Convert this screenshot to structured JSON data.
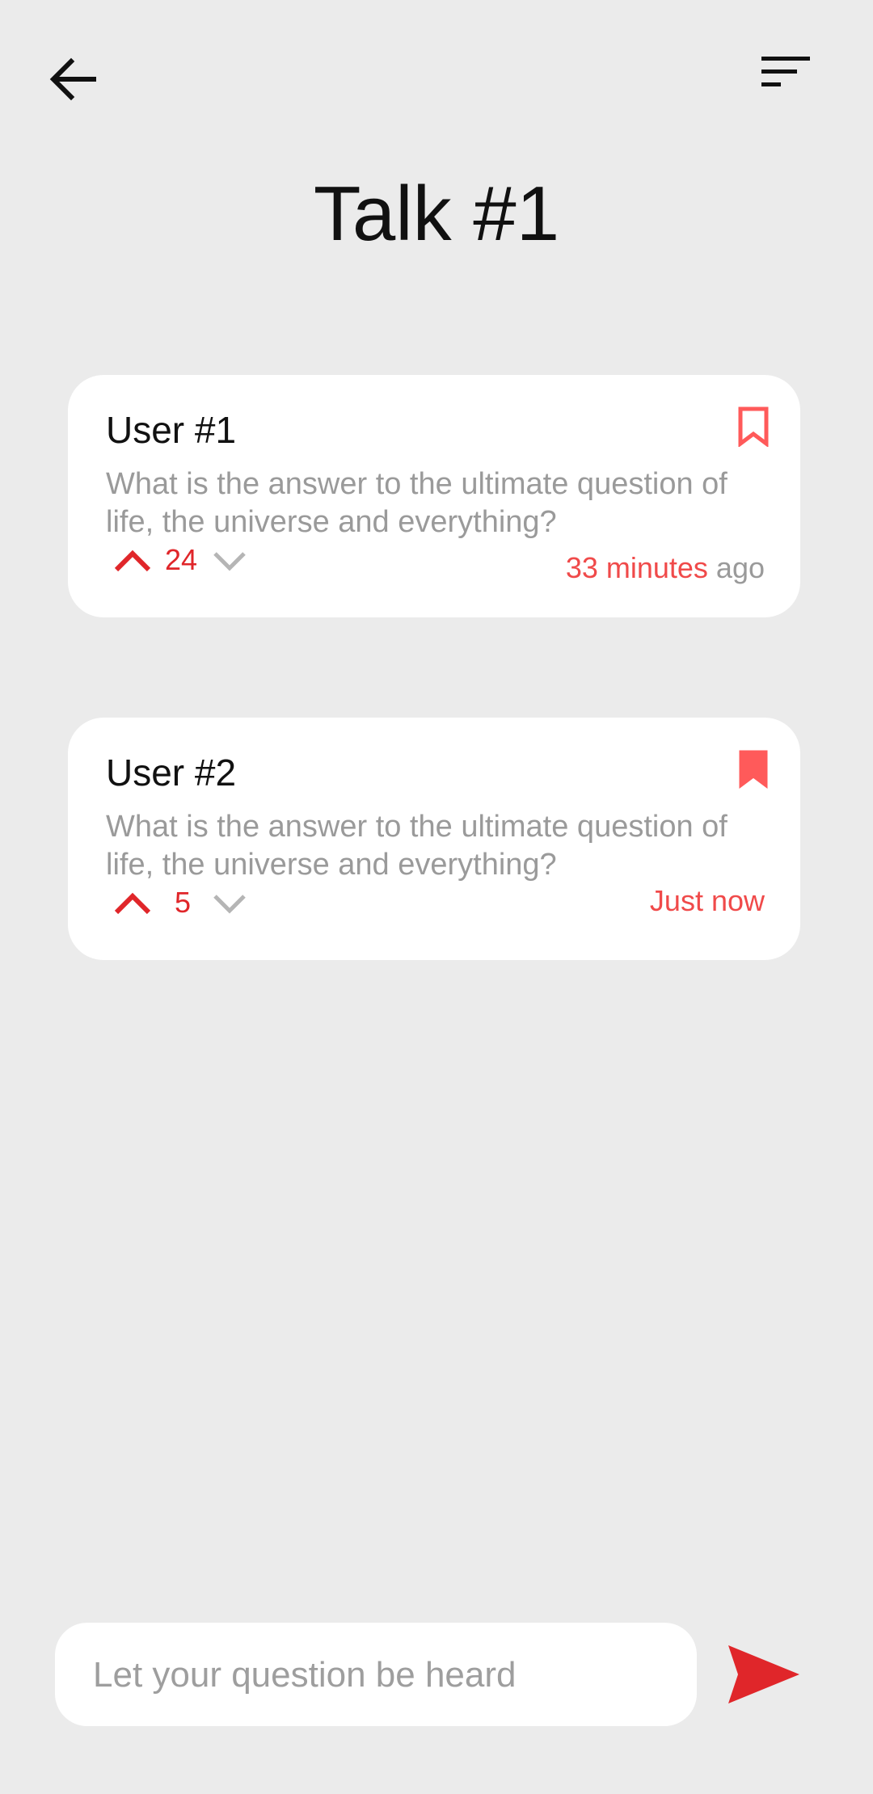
{
  "header": {
    "back_icon": "arrow-left-icon",
    "sort_icon": "sort-lines-icon",
    "title": "Talk #1"
  },
  "questions": [
    {
      "user": "User #1",
      "text": "What is the answer to the ultimate question of life, the universe and everything?",
      "votes": "24",
      "time_highlight": "33 minutes",
      "time_suffix": " ago",
      "bookmarked": false,
      "bookmark_icon": "bookmark-outline-icon"
    },
    {
      "user": "User #2",
      "text": "What is the answer to the ultimate question of life, the universe and everything?",
      "votes": "5",
      "time_highlight": "Just now",
      "time_suffix": "",
      "bookmarked": true,
      "bookmark_icon": "bookmark-filled-icon"
    }
  ],
  "composer": {
    "placeholder": "Let your question be heard",
    "value": "",
    "send_icon": "send-icon"
  },
  "colors": {
    "background": "#ebebeb",
    "accent_red": "#e0262a",
    "time_red": "#f04a4a",
    "bookmark_red": "#ff5a5a",
    "muted_text": "#9a9a9a"
  }
}
